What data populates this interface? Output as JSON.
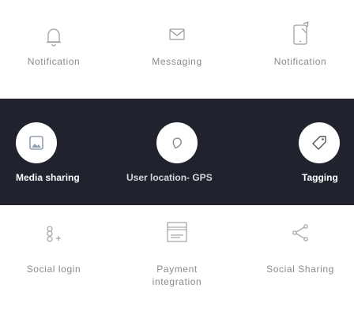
{
  "top_features": [
    {
      "label": "Notification",
      "icon": "bell-icon"
    },
    {
      "label": "Messaging",
      "icon": "envelope-icon"
    },
    {
      "label": "Notification",
      "icon": "phone-notification-icon"
    }
  ],
  "featured": [
    {
      "label": "Media sharing",
      "icon": "image-icon"
    },
    {
      "label": "User location- GPS",
      "icon": "location-pin-icon"
    },
    {
      "label": "Tagging",
      "icon": "tag-icon"
    }
  ],
  "bottom_features": [
    {
      "label": "Social login",
      "icon": "google-plus-icon"
    },
    {
      "label": "Payment",
      "label2": "integration",
      "icon": "payment-card-icon"
    },
    {
      "label": "Social Sharing",
      "icon": "share-icon"
    }
  ],
  "colors": {
    "band": "#20232d",
    "icon_stroke": "#9a9a9a",
    "label": "#8a8a8a"
  }
}
